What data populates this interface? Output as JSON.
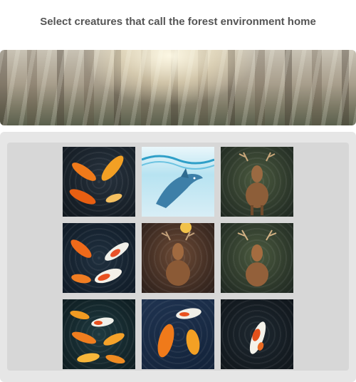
{
  "prompt": "Select creatures that call the forest environment home",
  "banner": {
    "icon": "forest-sunlight-image"
  },
  "grid": {
    "tiles": [
      {
        "subject": "koi-fish-image"
      },
      {
        "subject": "dolphin-image"
      },
      {
        "subject": "deer-image"
      },
      {
        "subject": "koi-fish-image"
      },
      {
        "subject": "deer-image"
      },
      {
        "subject": "deer-image"
      },
      {
        "subject": "koi-fish-image"
      },
      {
        "subject": "koi-fish-image"
      },
      {
        "subject": "koi-fish-image"
      }
    ]
  }
}
